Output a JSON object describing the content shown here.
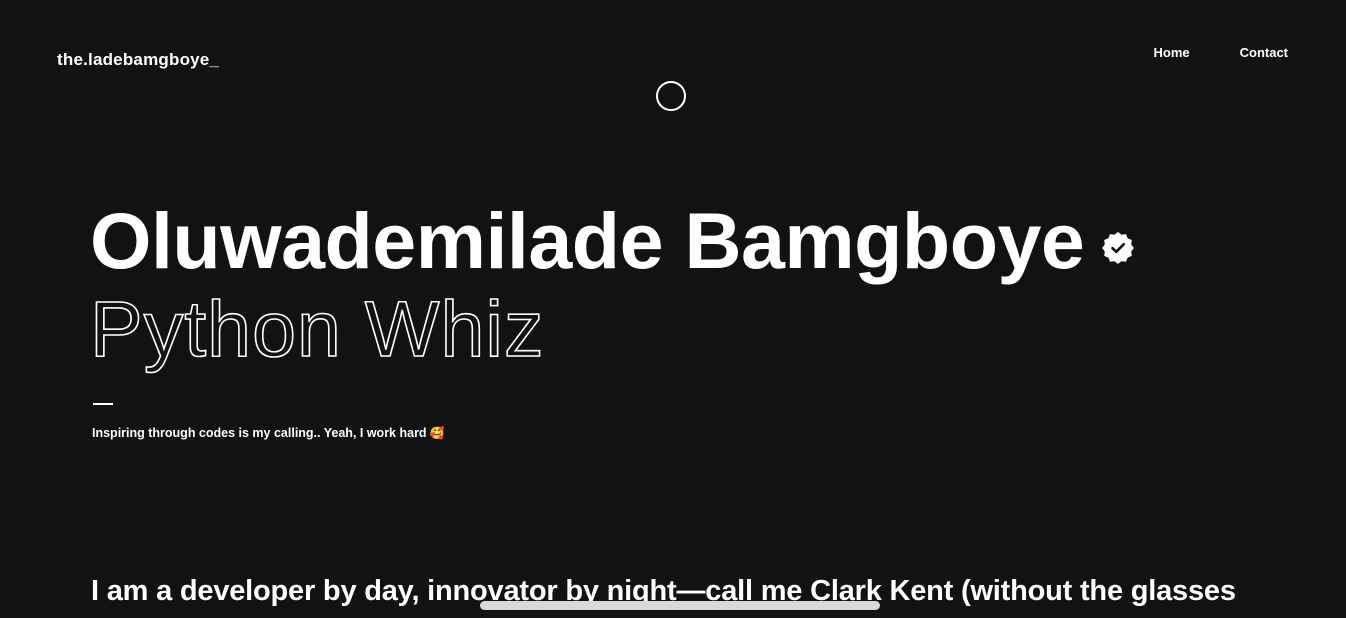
{
  "header": {
    "logo": "the.ladebamgboye_",
    "nav": [
      {
        "label": "Home"
      },
      {
        "label": "Contact"
      }
    ]
  },
  "hero": {
    "name": "Oluwademilade Bamgboye",
    "verified_icon": "verified-badge-icon",
    "role": "Python Whiz",
    "tagline": "Inspiring through codes is my calling.. Yeah, I work hard",
    "tagline_emoji": "🥰"
  },
  "about": {
    "intro": "I am a developer by day, innovator by night—call me Clark Kent (without the glasses"
  },
  "colors": {
    "background": "#111212",
    "text": "#ffffff",
    "scrollbar": "#d9d9d9"
  }
}
